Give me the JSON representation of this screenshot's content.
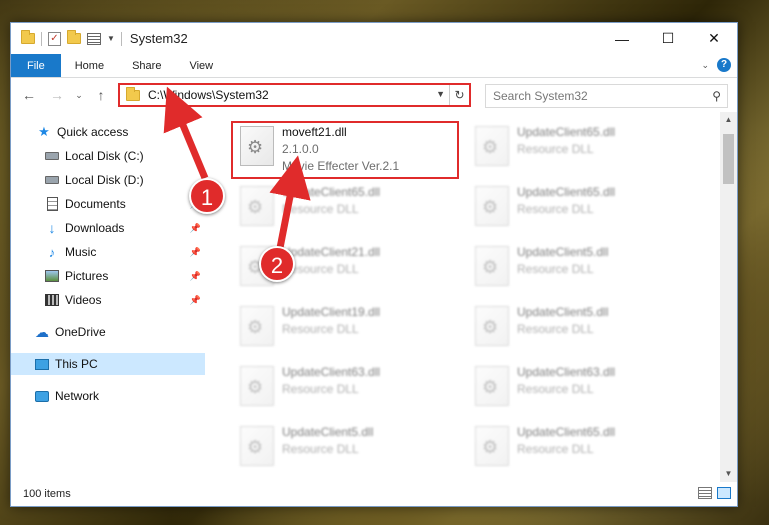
{
  "window": {
    "title": "System32",
    "controls": {
      "minimize": "—",
      "maximize": "☐",
      "close": "✕"
    }
  },
  "ribbon": {
    "tabs": [
      "File",
      "Home",
      "Share",
      "View"
    ],
    "help": "?"
  },
  "navigation": {
    "address": "C:\\Windows\\System32",
    "search_placeholder": "Search System32"
  },
  "sidebar": {
    "items": [
      {
        "label": "Quick access",
        "icon": "star-icon"
      },
      {
        "label": "Local Disk (C:)",
        "icon": "disk-icon"
      },
      {
        "label": "Local Disk (D:)",
        "icon": "disk-icon"
      },
      {
        "label": "Documents",
        "icon": "documents-icon",
        "pinned": true
      },
      {
        "label": "Downloads",
        "icon": "downloads-icon",
        "pinned": true
      },
      {
        "label": "Music",
        "icon": "music-icon",
        "pinned": true
      },
      {
        "label": "Pictures",
        "icon": "pictures-icon",
        "pinned": true
      },
      {
        "label": "Videos",
        "icon": "videos-icon",
        "pinned": true
      },
      {
        "label": "OneDrive",
        "icon": "cloud-icon"
      },
      {
        "label": "This PC",
        "icon": "computer-icon",
        "selected": true
      },
      {
        "label": "Network",
        "icon": "network-icon"
      }
    ]
  },
  "files": [
    {
      "name": "moveft21.dll",
      "line2": "2.1.0.0",
      "line3": "Movie Effecter Ver.2.1",
      "highlighted": true
    },
    {
      "name": "UpdateClient65.dll",
      "line2": "Resource DLL"
    },
    {
      "name": "UpdateClient65.dll",
      "line2": "Resource DLL"
    },
    {
      "name": "UpdateClient65.dll",
      "line2": "Resource DLL"
    },
    {
      "name": "UpdateClient21.dll",
      "line2": "Resource DLL"
    },
    {
      "name": "UpdateClient5.dll",
      "line2": "Resource DLL"
    },
    {
      "name": "UpdateClient19.dll",
      "line2": "Resource DLL"
    },
    {
      "name": "UpdateClient5.dll",
      "line2": "Resource DLL"
    },
    {
      "name": "UpdateClient63.dll",
      "line2": "Resource DLL"
    },
    {
      "name": "UpdateClient63.dll",
      "line2": "Resource DLL"
    },
    {
      "name": "UpdateClient5.dll",
      "line2": "Resource DLL"
    },
    {
      "name": "UpdateClient65.dll",
      "line2": "Resource DLL"
    }
  ],
  "status": {
    "item_count": "100 items"
  },
  "annotations": {
    "step1": "1",
    "step2": "2",
    "color": "#e02b2b"
  }
}
